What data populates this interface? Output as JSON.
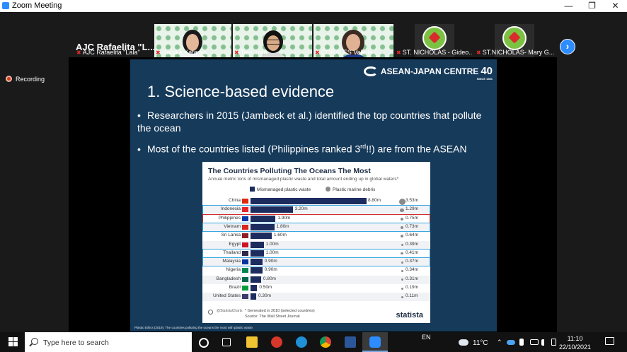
{
  "window": {
    "title": "Zoom Meeting"
  },
  "participants": {
    "active_name": "AJC Rafaelita \"L...",
    "tiles": [
      {
        "label": "AJC Rafaelita \"Lala\""
      },
      {
        "label": "Haruka Katarao"
      },
      {
        "label": "Tien Tran"
      },
      {
        "label": "CORALES Valerie"
      },
      {
        "label": "ST. NICHOLAS - Gideo..."
      },
      {
        "label": "ST.NICHOLAS- Mary G..."
      }
    ]
  },
  "recording": {
    "label": "Recording"
  },
  "slide": {
    "logo_text": "ASEAN-JAPAN CENTRE",
    "logo_number": "40",
    "logo_since": "SINCE 1981",
    "title": "1. Science-based evidence",
    "bullets": [
      "Researchers in 2015 (Jambeck et al.) identified the top countries that pollute the ocean",
      "Most of the countries listed (Philippines ranked 3",
      "rd",
      "!!) are from the ASEAN"
    ],
    "source_note": "Plastic Ethics (2019). The countries polluting the oceans the most with plastic waste."
  },
  "chart_data": {
    "type": "bar",
    "title": "The Countries Polluting The Oceans The Most",
    "subtitle": "Annual metric tons of mismanaged plastic waste and total amount ending up in global waters*",
    "legend": [
      "Mismanaged plastic waste",
      "Plastic marine debris"
    ],
    "categories": [
      "China",
      "Indonesia",
      "Philippines",
      "Vietnam",
      "Sri Lanka",
      "Egypt",
      "Thailand",
      "Malaysia",
      "Nigeria",
      "Bangladesh",
      "Brazil",
      "United States"
    ],
    "series": [
      {
        "name": "Mismanaged plastic waste",
        "values": [
          8.8,
          3.2,
          1.9,
          1.8,
          1.6,
          1.0,
          1.0,
          0.9,
          0.9,
          0.8,
          0.5,
          0.3
        ],
        "labels": [
          "8.80m",
          "3.20m",
          "1.90m",
          "1.80m",
          "1.60m",
          "1.00m",
          "1.00m",
          "0.90m",
          "0.90m",
          "0.80m",
          "0.50m",
          "0.30m"
        ]
      },
      {
        "name": "Plastic marine debris",
        "values": [
          3.53,
          1.29,
          0.75,
          0.73,
          0.64,
          0.39,
          0.41,
          0.37,
          0.34,
          0.31,
          0.19,
          0.11
        ],
        "labels": [
          "3.53m",
          "1.29m",
          "0.75m",
          "0.73m",
          "0.64m",
          "0.39m",
          "0.41m",
          "0.37m",
          "0.34m",
          "0.31m",
          "0.19m",
          "0.11m"
        ]
      }
    ],
    "highlights": {
      "blue": [
        "Indonesia",
        "Vietnam",
        "Thailand",
        "Malaysia"
      ],
      "red": [
        "Philippines"
      ]
    },
    "footnote": "* Generated in 2010 (selected countries)",
    "source": "Source: The Wall Street Journal",
    "brand": "statista",
    "handle": "@StatistaCharts"
  },
  "taskbar": {
    "search_placeholder": "Type here to search",
    "temperature": "11°C",
    "language": "EN",
    "time": "11:10",
    "date": "22/10/2021"
  },
  "colors": {
    "zoom_blue": "#2d8cff",
    "slide_bg": "#163a5a",
    "bar": "#1d2c5e",
    "highlight_blue": "#3aa7e0",
    "highlight_red": "#d42c2c"
  }
}
